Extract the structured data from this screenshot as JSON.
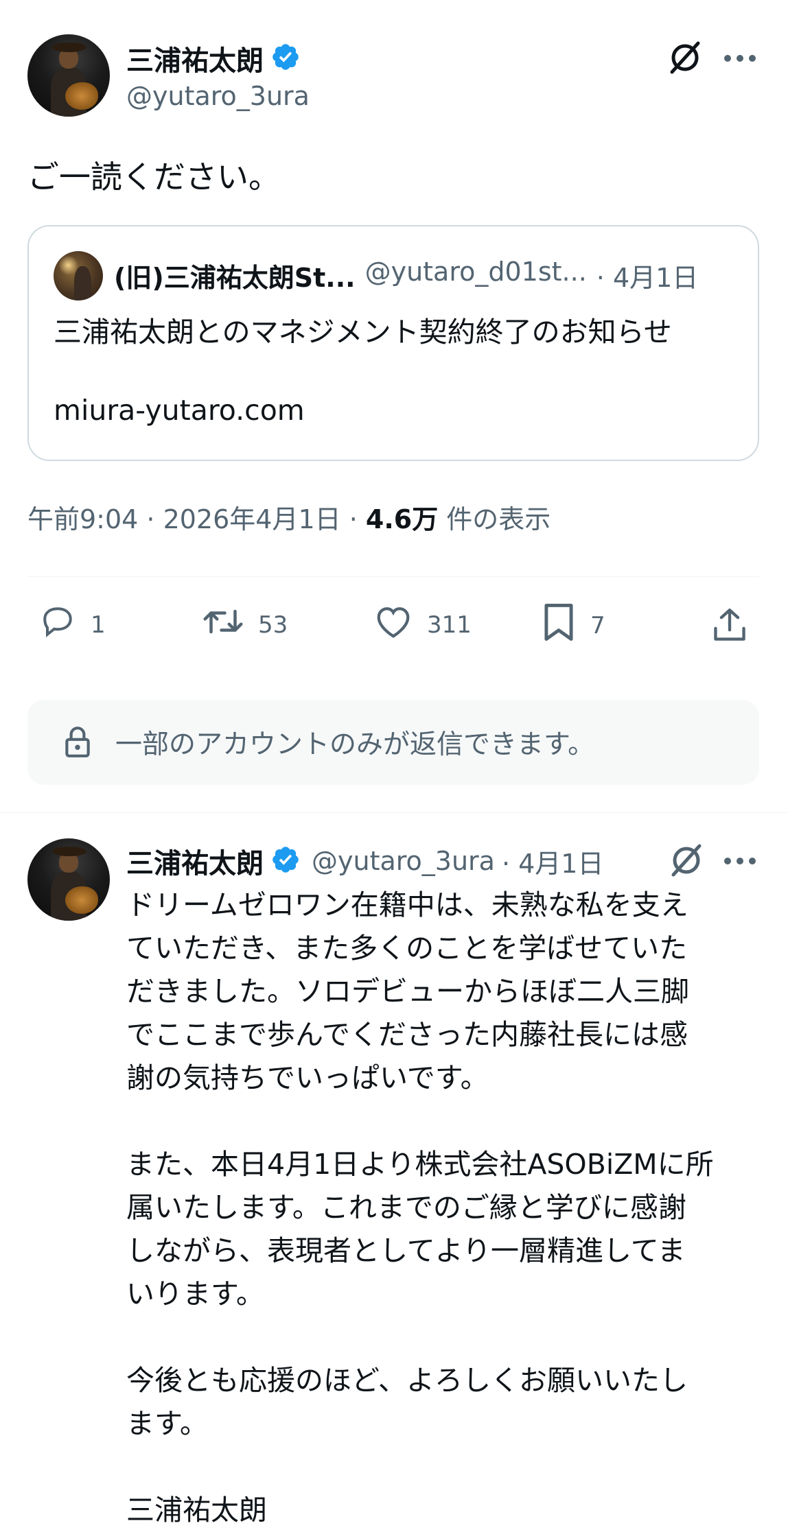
{
  "main_tweet": {
    "display_name": "三浦祐太朗",
    "handle": "@yutaro_3ura",
    "text": "ご一読ください。",
    "grok_icon": "grok-icon",
    "more_icon": "more-dots-icon"
  },
  "quoted_tweet": {
    "display_name": "(旧)三浦祐太朗St...",
    "handle": "@yutaro_d01st...",
    "date": "· 4月1日",
    "text": "三浦祐太朗とのマネジメント契約終了のお知らせ",
    "link": "miura-yutaro.com"
  },
  "meta": {
    "time": "午前9:04 · 2026年4月1日 · ",
    "views_count": "4.6万",
    "views_label": " 件の表示"
  },
  "actions": {
    "replies": "1",
    "retweets": "53",
    "likes": "311",
    "bookmarks": "7"
  },
  "restriction": {
    "text": "一部のアカウントのみが返信できます。"
  },
  "reply_tweet": {
    "display_name": "三浦祐太朗",
    "handle": "@yutaro_3ura",
    "date": "· 4月1日",
    "text": "ドリームゼロワン在籍中は、未熟な私を支え\nていただき、また多くのことを学ばせていた\nだきました。ソロデビューからほぼ二人三脚\nでここまで歩んでくださった内藤社長には感\n謝の気持ちでいっぱいです。\n\nまた、本日4月1日より株式会社ASOBiZMに所\n属いたします。これまでのご縁と学びに感謝\nしながら、表現者としてより一層精進してま\nいります。\n\n今後とも応援のほど、よろしくお願いいたし\nます。\n\n三浦祐太朗"
  },
  "colors": {
    "verified": "#1d9bf0",
    "muted": "#536471",
    "border": "#cfd9de",
    "restrict_bg": "#f7f9f9"
  }
}
